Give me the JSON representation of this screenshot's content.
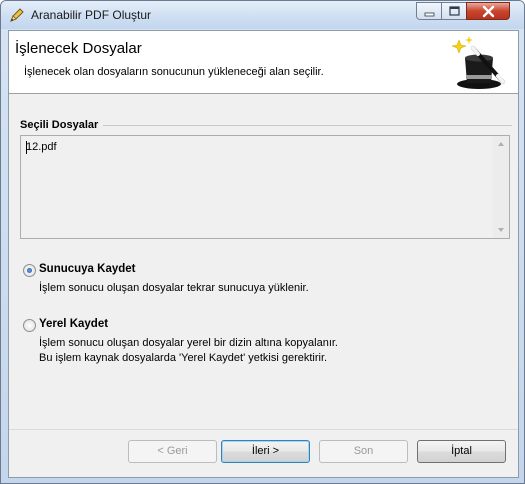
{
  "window": {
    "title": "Aranabilir PDF Oluştur",
    "controls": [
      "minimize-icon",
      "maximize-icon",
      "close-icon"
    ]
  },
  "header": {
    "title": "İşlenecek Dosyalar",
    "subtitle": "İşlenecek olan dosyaların sonucunun yükleneceği alan seçilir.",
    "icon": "magic-wand-hat-icon"
  },
  "files": {
    "group_label": "Seçili Dosyalar",
    "items": [
      "12.pdf"
    ]
  },
  "options": [
    {
      "label": "Sunucuya Kaydet",
      "selected": true,
      "description": [
        "İşlem sonucu oluşan dosyalar tekrar sunucuya yüklenir."
      ]
    },
    {
      "label": "Yerel Kaydet",
      "selected": false,
      "description": [
        "İşlem sonucu oluşan dosyalar yerel bir dizin altına kopyalanır.",
        "Bu işlem kaynak dosyalarda 'Yerel Kaydet' yetkisi gerektirir."
      ]
    }
  ],
  "buttons": {
    "back": "< Geri",
    "next": "İleri >",
    "finish": "Son",
    "cancel": "İptal"
  },
  "colors": {
    "accent": "#3c7fb1",
    "radio_selected": "#1c4f9a",
    "close_button": "#c9452f"
  }
}
